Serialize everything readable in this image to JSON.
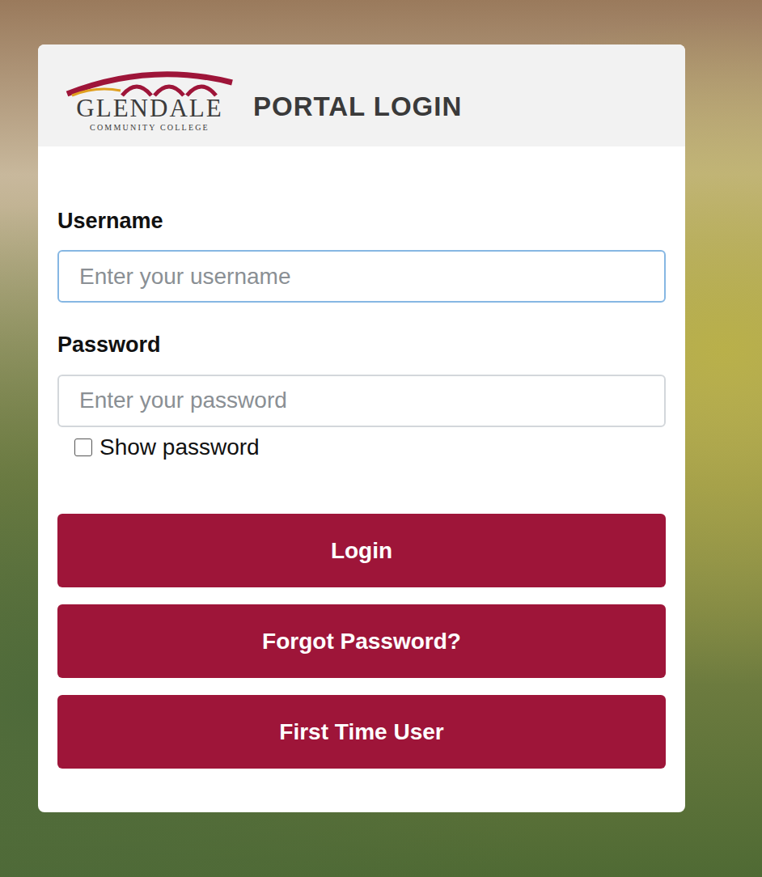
{
  "logo": {
    "name": "GLENDALE",
    "subtitle": "COMMUNITY COLLEGE"
  },
  "title": "PORTAL LOGIN",
  "fields": [
    {
      "label": "Username",
      "placeholder": "Enter your username",
      "kind": "text",
      "focused": true
    },
    {
      "label": "Password",
      "placeholder": "Enter your password",
      "kind": "password",
      "focused": false
    }
  ],
  "show_password": {
    "label": "Show password",
    "checked": false
  },
  "buttons": [
    "Login",
    "Forgot Password?",
    "First Time User"
  ]
}
